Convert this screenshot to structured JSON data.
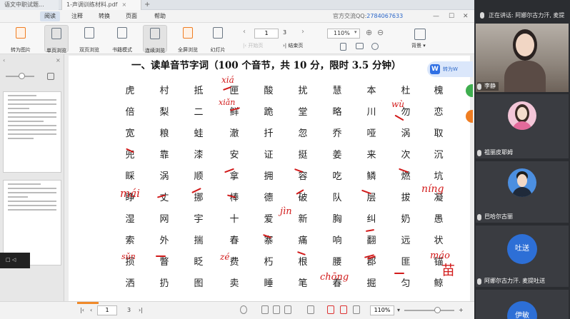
{
  "tabs": [
    {
      "label": "语文中职试题..."
    },
    {
      "label": "1-声调训练材料.pdf"
    }
  ],
  "menu": {
    "items": [
      "阅读",
      "注释",
      "转换",
      "页面",
      "帮助"
    ],
    "active_index": 0,
    "phone_label": "官方交流QQ:",
    "phone_number": "2784067633"
  },
  "toolbar": {
    "tools": [
      "转为图片",
      "单页浏览",
      "双页浏览",
      "书籍模式",
      "连续浏览",
      "全屏浏览",
      "幻灯片"
    ],
    "page_current": "1",
    "page_total": "3",
    "prev_label": "上一页",
    "start_label": "开始页",
    "next_label": "下一页",
    "end_label": "结束页",
    "zoom": "110%",
    "background_label": "背景"
  },
  "document": {
    "title": "一、读单音节字词（100 个音节，共 10 分，限时 3.5 分钟）",
    "grid": [
      [
        "虎",
        "村",
        "抵",
        "匣",
        "酸",
        "扰",
        "慧",
        "本",
        "杜",
        "槐"
      ],
      [
        "倍",
        "梨",
        "二",
        "鲜",
        "跪",
        "堂",
        "略",
        "川",
        "勿",
        "恋"
      ],
      [
        "宽",
        "粮",
        "蛙",
        "澈",
        "扦",
        "忽",
        "乔",
        "哑",
        "涡",
        "取"
      ],
      [
        "兜",
        "靠",
        "漆",
        "安",
        "证",
        "挺",
        "姜",
        "来",
        "次",
        "沉"
      ],
      [
        "睬",
        "涡",
        "顺",
        "拿",
        "拥",
        "容",
        "吃",
        "鳞",
        "燃",
        "坑"
      ],
      [
        "睁",
        "丈",
        "挪",
        "棒",
        "德",
        "破",
        "队",
        "层",
        "拔",
        "凝"
      ],
      [
        "湿",
        "网",
        "宇",
        "十",
        "爱",
        "新",
        "胸",
        "纠",
        "奶",
        "愚"
      ],
      [
        "索",
        "外",
        "揣",
        "春",
        "寨",
        "痛",
        "响",
        "翻",
        "远",
        "状"
      ],
      [
        "损",
        "瞥",
        "眨",
        "费",
        "朽",
        "根",
        "腰",
        "郡",
        "匪",
        "锚"
      ],
      [
        "洒",
        "扔",
        "图",
        "卖",
        "睡",
        "笔",
        "春",
        "掘",
        "匀",
        "鲸"
      ]
    ],
    "annotations": [
      "xiá",
      "xiǎn",
      "wù",
      "mái",
      "jìn",
      "níng",
      "sǔn",
      "zé",
      "chōng",
      "máo",
      "苗"
    ],
    "convert_button": "转为W"
  },
  "statusbar": {
    "page_current": "1",
    "page_total": "3",
    "zoom": "110%"
  },
  "meeting": {
    "speaking_label": "正在讲话: 阿娜尔古力汗, 麦提",
    "participants": [
      {
        "name": "李静",
        "initial": ""
      },
      {
        "name": "祖丽皮耶姆",
        "initial": ""
      },
      {
        "name": "巴哈尔古丽",
        "initial": ""
      },
      {
        "name": "阿娜尔古力汗. 麦提吐送",
        "initial": "吐送"
      },
      {
        "name": "",
        "initial": "伊敏"
      }
    ]
  },
  "colors": {
    "annotation_red": "#d21a1a",
    "accent_blue": "#2d6fd6",
    "toolbar_orange": "#ef7d22"
  }
}
